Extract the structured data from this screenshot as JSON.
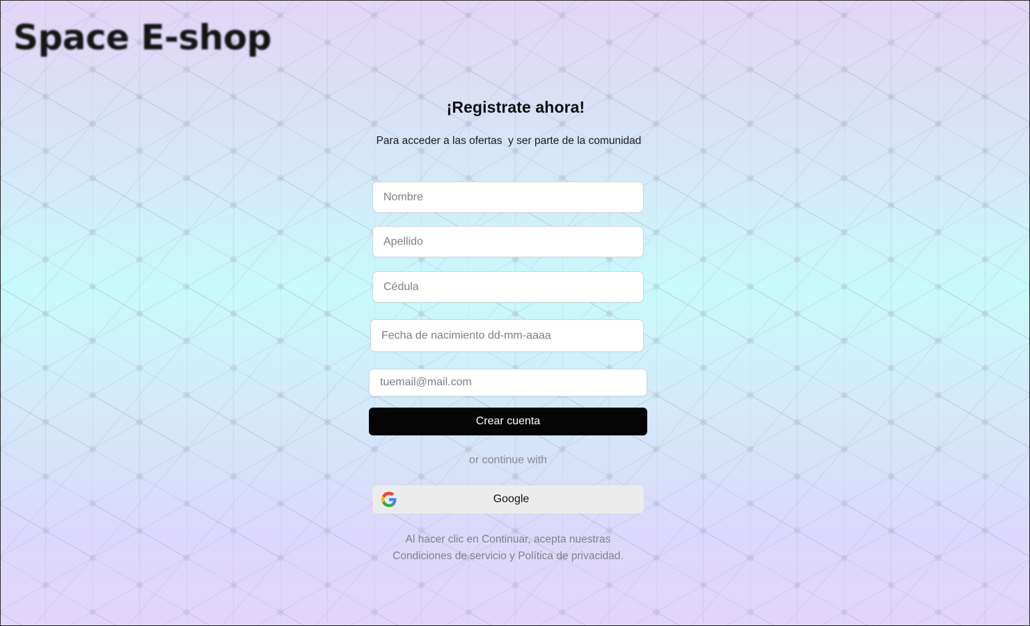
{
  "brand": {
    "logo_text": "Space E-shop"
  },
  "signup": {
    "title": "¡Registrate ahora!",
    "subtitle": "Para acceder a las ofertas  y ser parte de la comunidad",
    "fields": {
      "first_name": {
        "placeholder": "Nombre",
        "value": ""
      },
      "last_name": {
        "placeholder": "Apellido",
        "value": ""
      },
      "id_number": {
        "placeholder": "Cédula",
        "value": ""
      },
      "birth_date": {
        "placeholder": "Fecha de nacimiento dd-mm-aaaa",
        "value": ""
      },
      "email": {
        "placeholder": "tuemail@mail.com",
        "value": ""
      }
    },
    "submit_label": "Crear cuenta",
    "divider_text": "or continue with",
    "google_label": "Google",
    "google_icon": "google-icon",
    "legal_line1": "Al hacer clic en Continuar, acepta nuestras",
    "legal_line2": "Condiciones de servicio y Política de privacidad."
  },
  "colors": {
    "primary_button": "#050505",
    "google_button": "#ececec",
    "muted_text": "#7d8289",
    "background_top": "#e3d5f7",
    "background_middle": "#c8fbfb",
    "background_bottom": "#e2d6f8"
  }
}
